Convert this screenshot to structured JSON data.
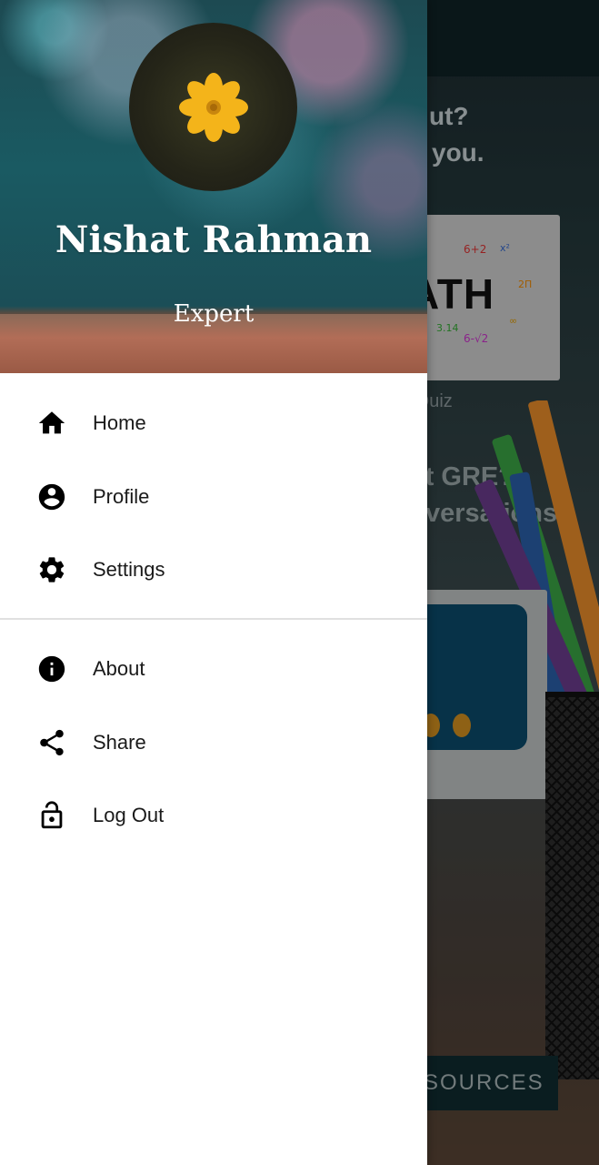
{
  "drawer": {
    "user_name": "Nishat Rahman",
    "user_role": "Expert",
    "primary_items": [
      {
        "label": "Home",
        "icon": "home-icon"
      },
      {
        "label": "Profile",
        "icon": "account-circle-icon"
      },
      {
        "label": "Settings",
        "icon": "gear-icon"
      }
    ],
    "secondary_items": [
      {
        "label": "About",
        "icon": "info-icon"
      },
      {
        "label": "Share",
        "icon": "share-icon"
      },
      {
        "label": "Log Out",
        "icon": "lock-open-icon"
      }
    ]
  },
  "background": {
    "heading_line1": "ut?",
    "heading_line2": "you.",
    "card_image_text": "ATH",
    "card_caption": "h Quiz",
    "heading2_line1": "ut GRE?",
    "heading2_line2": "versations",
    "button_label": "SOURCES"
  },
  "colors": {
    "drawer_bg": "#ffffff",
    "icon_color": "#000000",
    "header_teal": "#1d4a52",
    "flower_yellow": "#f4b41a"
  }
}
